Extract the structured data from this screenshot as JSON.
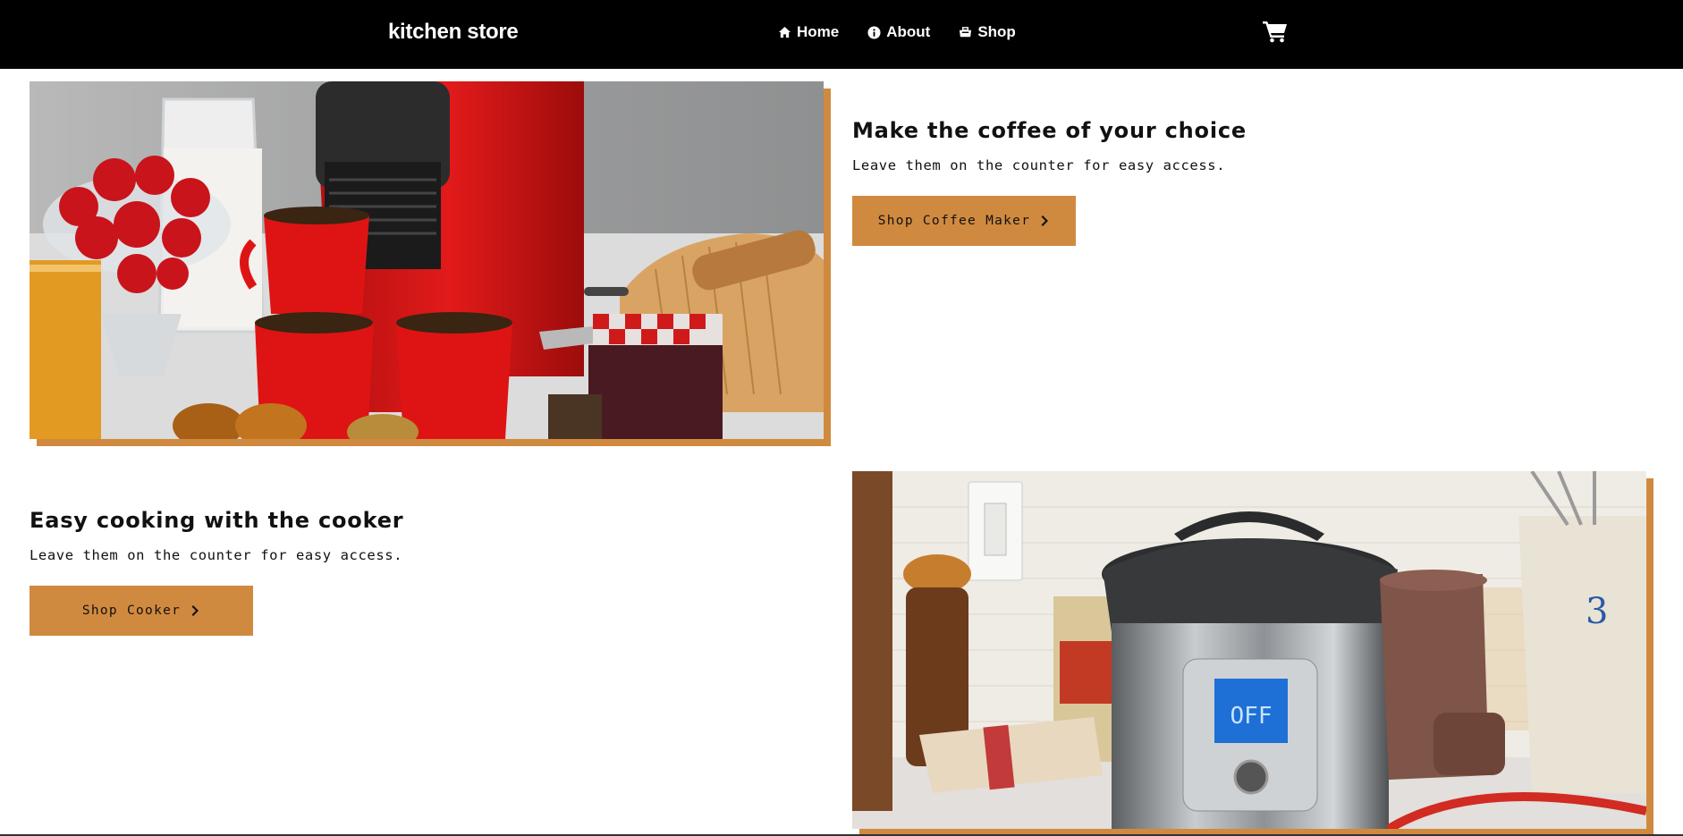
{
  "brand": {
    "name": "kitchen store"
  },
  "nav": {
    "items": [
      {
        "label": "Home",
        "icon": "home-icon"
      },
      {
        "label": "About",
        "icon": "info-icon"
      },
      {
        "label": "Shop",
        "icon": "shop-icon"
      }
    ],
    "cart_icon": "cart-icon"
  },
  "features": [
    {
      "title": "Make the coffee of your choice",
      "subtitle": "Leave them on the counter for easy access.",
      "cta": "Shop Coffee Maker",
      "cta_icon": "chevron-right-icon",
      "image": "coffee-maker-photo"
    },
    {
      "title": "Easy cooking with the cooker",
      "subtitle": "Leave them on the counter for easy access.",
      "cta": "Shop Cooker",
      "cta_icon": "chevron-right-icon",
      "image": "pressure-cooker-photo",
      "cooker_display": "OFF"
    }
  ],
  "colors": {
    "accent": "#d08a3f",
    "navbar": "#000000"
  }
}
